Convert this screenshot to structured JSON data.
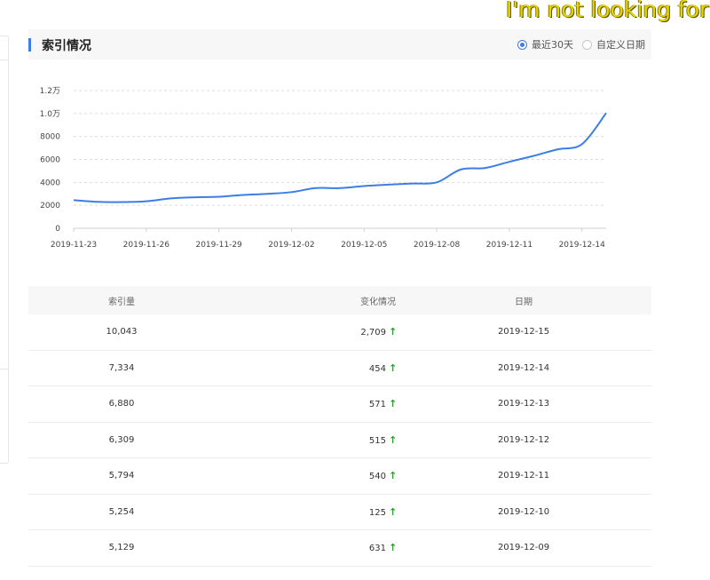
{
  "watermark": "I'm not looking for",
  "panel": {
    "title": "索引情况",
    "radio_recent_label": "最近30天",
    "radio_custom_label": "自定义日期",
    "selected": "最近30天"
  },
  "colors": {
    "accent": "#3c7de6",
    "up_arrow": "#2a9d2a",
    "line": "#3c7de6"
  },
  "chart_data": {
    "type": "line",
    "y_ticks": [
      "0",
      "2000",
      "4000",
      "6000",
      "8000",
      "1.0万",
      "1.2万"
    ],
    "x_ticks": [
      "2019-11-23",
      "2019-11-26",
      "2019-11-29",
      "2019-12-02",
      "2019-12-05",
      "2019-12-08",
      "2019-12-11",
      "2019-12-14"
    ],
    "ylim": [
      0,
      12000
    ],
    "grid": true,
    "x": [
      "2019-11-23",
      "2019-11-24",
      "2019-11-25",
      "2019-11-26",
      "2019-11-27",
      "2019-11-28",
      "2019-11-29",
      "2019-11-30",
      "2019-12-01",
      "2019-12-02",
      "2019-12-03",
      "2019-12-04",
      "2019-12-05",
      "2019-12-06",
      "2019-12-07",
      "2019-12-08",
      "2019-12-09",
      "2019-12-10",
      "2019-12-11",
      "2019-12-12",
      "2019-12-13",
      "2019-12-14",
      "2019-12-15"
    ],
    "series": [
      {
        "values": [
          2450,
          2300,
          2280,
          2350,
          2600,
          2700,
          2750,
          2900,
          3000,
          3150,
          3500,
          3500,
          3680,
          3800,
          3900,
          4000,
          5129,
          5254,
          5794,
          6309,
          6880,
          7334,
          10043
        ]
      }
    ]
  },
  "table": {
    "headers": [
      "索引量",
      "变化情况",
      "日期"
    ],
    "rows": [
      {
        "count": "10,043",
        "change": "2,709",
        "date": "2019-12-15"
      },
      {
        "count": "7,334",
        "change": "454",
        "date": "2019-12-14"
      },
      {
        "count": "6,880",
        "change": "571",
        "date": "2019-12-13"
      },
      {
        "count": "6,309",
        "change": "515",
        "date": "2019-12-12"
      },
      {
        "count": "5,794",
        "change": "540",
        "date": "2019-12-11"
      },
      {
        "count": "5,254",
        "change": "125",
        "date": "2019-12-10"
      },
      {
        "count": "5,129",
        "change": "631",
        "date": "2019-12-09"
      }
    ],
    "arrow_icon": "arrow-up-icon"
  }
}
